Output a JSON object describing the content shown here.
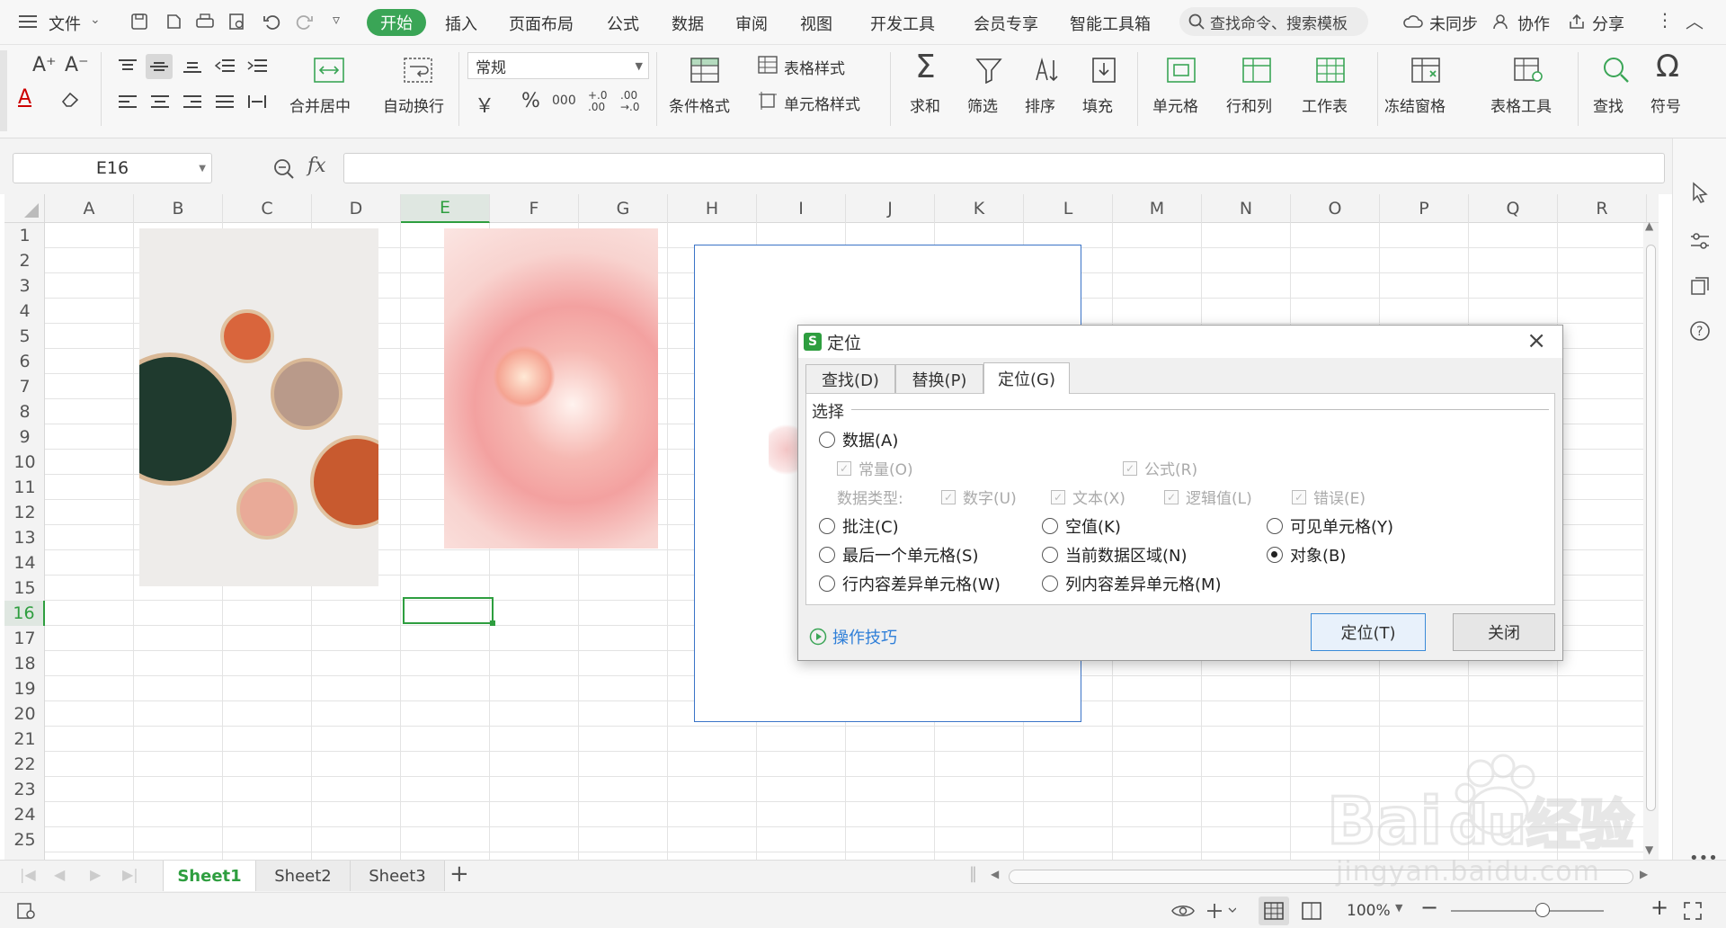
{
  "menubar": {
    "file": "文件",
    "tabs": [
      "开始",
      "插入",
      "页面布局",
      "公式",
      "数据",
      "审阅",
      "视图",
      "开发工具",
      "会员专享",
      "智能工具箱"
    ],
    "search_placeholder": "查找命令、搜索模板",
    "sync": "未同步",
    "collab": "协作",
    "share": "分享"
  },
  "ribbon": {
    "merge_center": "合并居中",
    "auto_wrap": "自动换行",
    "number_format": "常规",
    "conditional_format": "条件格式",
    "table_style": "表格样式",
    "cell_style": "单元格样式",
    "sum": "求和",
    "filter": "筛选",
    "sort": "排序",
    "fill": "填充",
    "cell": "单元格",
    "row_col": "行和列",
    "worksheet": "工作表",
    "freeze": "冻结窗格",
    "table_tools": "表格工具",
    "find": "查找",
    "symbol": "符号",
    "currency_symbol": "￥",
    "percent_symbol": "%",
    "thousands_symbol": "000",
    "decimal_add": "+.0 .00",
    "decimal_remove": ".00 →.0"
  },
  "formula_bar": {
    "cell_ref": "E16",
    "fx": "fx",
    "content": ""
  },
  "grid": {
    "columns": [
      "A",
      "B",
      "C",
      "D",
      "E",
      "F",
      "G",
      "H",
      "I",
      "J",
      "K",
      "L",
      "M",
      "N",
      "O",
      "P",
      "Q",
      "R"
    ],
    "rows": [
      "1",
      "2",
      "3",
      "4",
      "5",
      "6",
      "7",
      "8",
      "9",
      "10",
      "11",
      "12",
      "13",
      "14",
      "15",
      "16",
      "17",
      "18",
      "19",
      "20",
      "21",
      "22",
      "23",
      "24",
      "25"
    ],
    "active_column": "E",
    "active_row": "16"
  },
  "sheets": {
    "tabs": [
      "Sheet1",
      "Sheet2",
      "Sheet3"
    ],
    "active": "Sheet1",
    "add": "+"
  },
  "status": {
    "zoom": "100%"
  },
  "dialog": {
    "title": "定位",
    "tabs": [
      "查找(D)",
      "替换(P)",
      "定位(G)"
    ],
    "active_tab": "定位(G)",
    "section": "选择",
    "data": "数据(A)",
    "constant": "常量(O)",
    "formula": "公式(R)",
    "data_type_label": "数据类型:",
    "number": "数字(U)",
    "text": "文本(X)",
    "logic": "逻辑值(L)",
    "error": "错误(E)",
    "comment": "批注(C)",
    "blank": "空值(K)",
    "visible": "可见单元格(Y)",
    "last_cell": "最后一个单元格(S)",
    "current_region": "当前数据区域(N)",
    "object": "对象(B)",
    "row_diff": "行内容差异单元格(W)",
    "col_diff": "列内容差异单元格(M)",
    "tips": "操作技巧",
    "locate_btn": "定位(T)",
    "close_btn": "关闭",
    "selected": "对象(B)"
  },
  "watermark": {
    "brand": "Baidu经验",
    "url": "jingyan.baidu.com"
  },
  "colors": {
    "accent": "#3aa556",
    "link": "#2f7fd8",
    "selection": "#2e9e3f"
  }
}
